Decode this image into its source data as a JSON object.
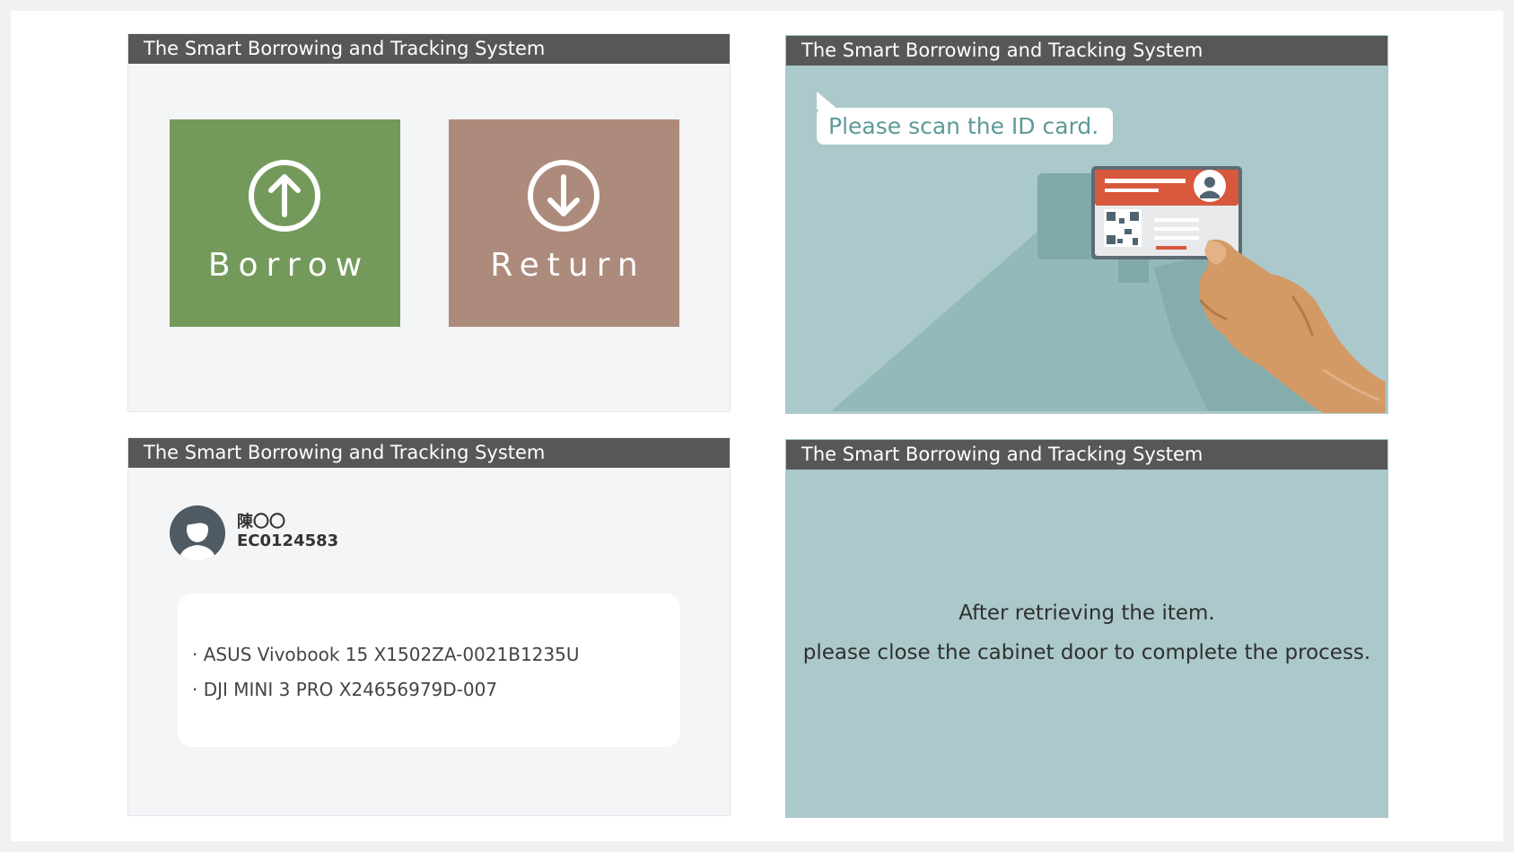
{
  "system_title": "The Smart Borrowing and Tracking System",
  "menu": {
    "borrow_label": "Borrow",
    "return_label": "Return",
    "borrow_color": "#739a5a",
    "return_color": "#ad8b7c",
    "borrow_icon": "arrow-up-circle-icon",
    "return_icon": "arrow-down-circle-icon"
  },
  "scan": {
    "prompt": "Please scan the ID card.",
    "illustration": "hand-holding-id-card"
  },
  "user": {
    "name": "陳〇〇",
    "employee_id": "EC0124583",
    "items": [
      "· ASUS Vivobook 15 X1502ZA-0021B1235U",
      "· DJI MINI 3 PRO X24656979D-007"
    ]
  },
  "completion": {
    "line1": "After retrieving the item.",
    "line2": "please close the cabinet door to complete the process."
  },
  "colors": {
    "header": "#575757",
    "teal_background": "#abc9ca",
    "light_background": "#f4f5f7"
  }
}
